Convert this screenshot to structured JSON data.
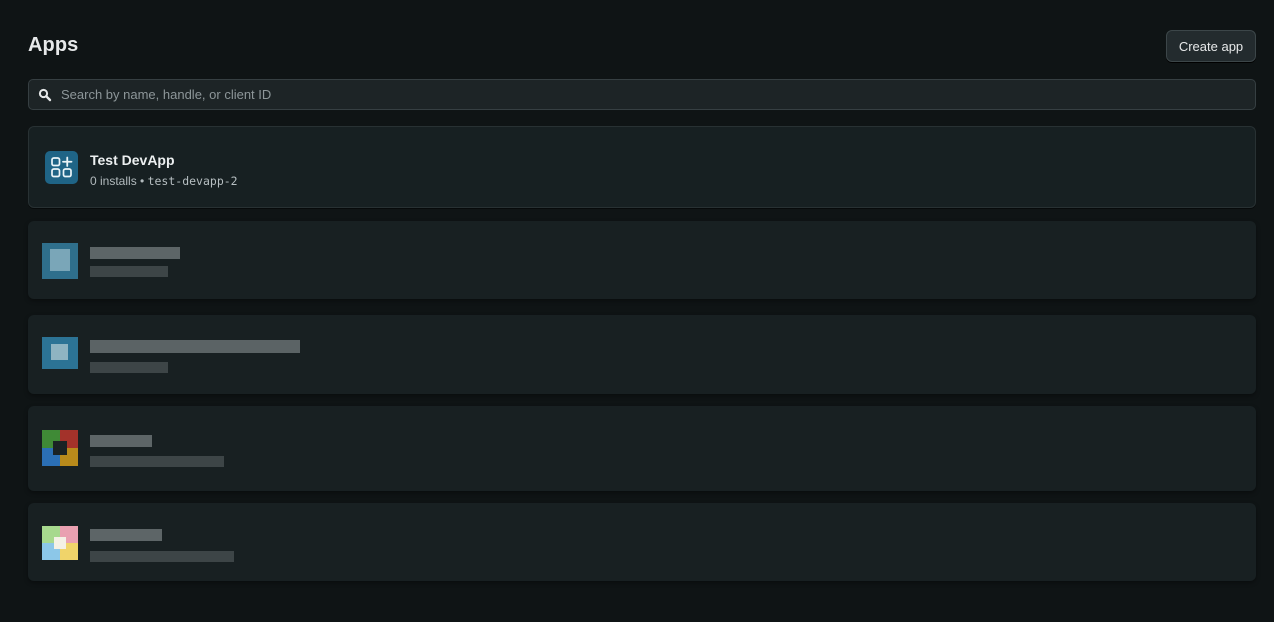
{
  "header": {
    "title": "Apps",
    "create_button_label": "Create app"
  },
  "search": {
    "icon": "search-icon",
    "placeholder": "Search by name, handle, or client ID",
    "value": ""
  },
  "apps": [
    {
      "name": "Test DevApp",
      "installs": "0 installs",
      "separator": "•",
      "handle": "test-devapp-2",
      "icon": "app-grid-plus-icon"
    }
  ],
  "colors": {
    "background": "#0f1415",
    "card": "#172022",
    "icon_bg": "#1f6486",
    "text_primary": "#eceff0",
    "text_secondary": "#b2babd"
  }
}
